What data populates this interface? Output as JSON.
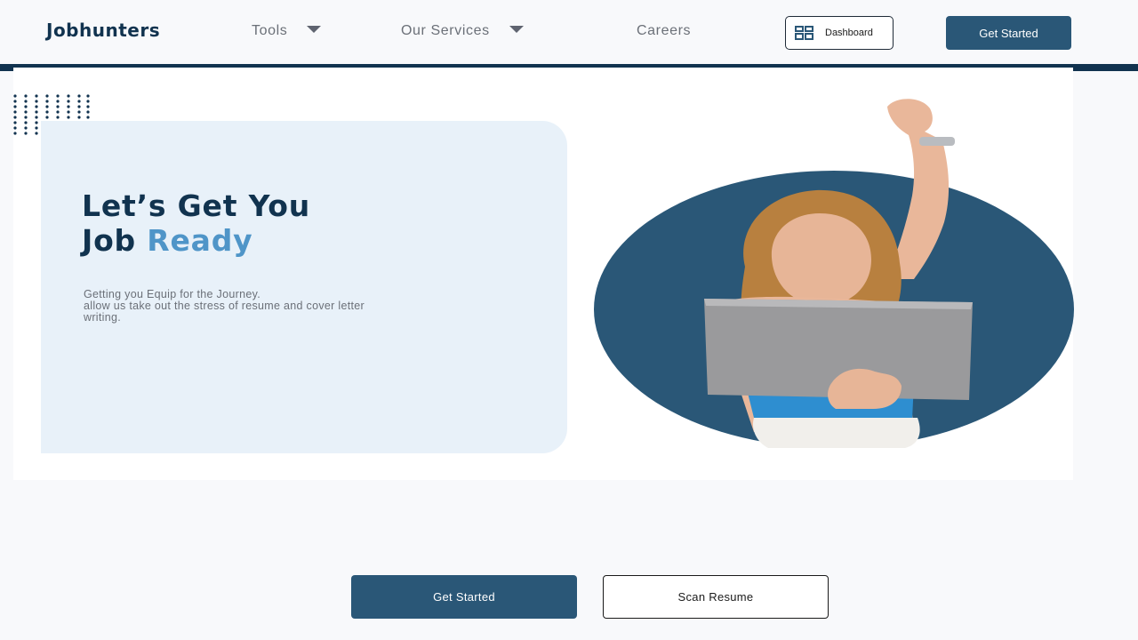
{
  "header": {
    "logo_text": "Jobhunters",
    "nav": [
      {
        "label": "Tools",
        "has_dropdown": true
      },
      {
        "label": "Our Services",
        "has_dropdown": true
      },
      {
        "label": "Careers",
        "has_dropdown": false
      }
    ],
    "dashboard_label": "Dashboard",
    "get_started_label": "Get Started"
  },
  "hero": {
    "title_line1": "Let’s Get You",
    "title_line2_main": "Job ",
    "title_line2_accent": "Ready",
    "desc_line1": "Getting you Equip for the Journey.",
    "desc_line2": "allow us take out the stress of resume and cover letter",
    "desc_line3": "writing."
  },
  "cta": {
    "primary_label": "Get Started",
    "secondary_label": "Scan Resume"
  },
  "colors": {
    "brand_dark": "#11334f",
    "brand_button": "#2a5777",
    "accent": "#4f95c8",
    "card_bg": "#e8f1f9"
  }
}
